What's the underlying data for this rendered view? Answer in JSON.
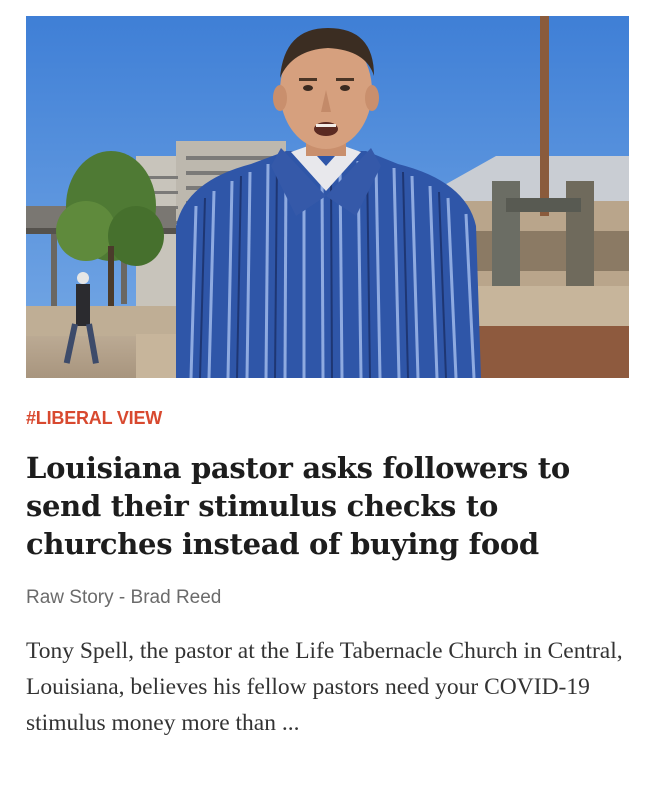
{
  "article": {
    "image_alt": "Man in blue striped shirt speaking outdoors in a plaza",
    "category_tag": "#LIBERAL VIEW",
    "headline": "Louisiana pastor asks followers to send their stimulus checks to churches instead of buying food",
    "source": "Raw Story",
    "byline_separator": " - ",
    "author": "Brad Reed",
    "summary": "Tony Spell, the pastor at the Life Tabernacle Church in Central, Louisiana, believes his fellow pastors need your COVID-19 stimulus money more than ..."
  },
  "colors": {
    "tag": "#d8492f",
    "headline": "#1d1d1d",
    "byline": "#6b6b6b",
    "summary": "#333333"
  }
}
